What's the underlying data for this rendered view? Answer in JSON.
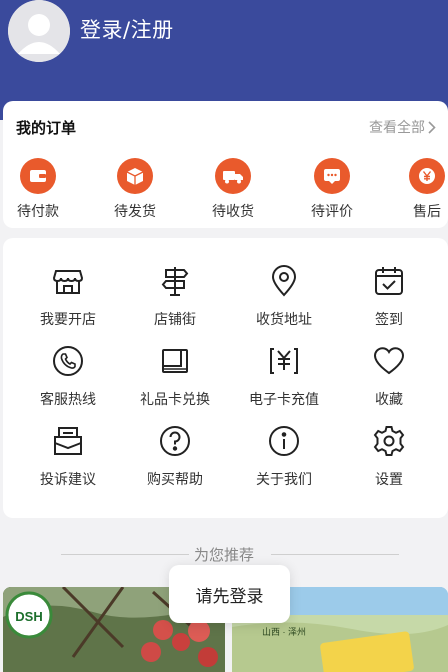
{
  "header": {
    "login_label": "登录/注册"
  },
  "orders": {
    "title": "我的订单",
    "view_all": "查看全部",
    "items": [
      {
        "label": "待付款",
        "icon": "wallet-icon"
      },
      {
        "label": "待发货",
        "icon": "box-icon"
      },
      {
        "label": "待收货",
        "icon": "truck-icon"
      },
      {
        "label": "待评价",
        "icon": "comment-icon"
      },
      {
        "label": "售后",
        "icon": "yen-icon"
      }
    ]
  },
  "services": [
    {
      "label": "我要开店",
      "icon": "store-icon"
    },
    {
      "label": "店铺街",
      "icon": "signpost-icon"
    },
    {
      "label": "收货地址",
      "icon": "location-icon"
    },
    {
      "label": "签到",
      "icon": "calendar-check-icon"
    },
    {
      "label": "客服热线",
      "icon": "phone-icon"
    },
    {
      "label": "礼品卡兑换",
      "icon": "gift-card-icon"
    },
    {
      "label": "电子卡充值",
      "icon": "yen-card-icon"
    },
    {
      "label": "收藏",
      "icon": "heart-icon"
    },
    {
      "label": "投诉建议",
      "icon": "mail-icon"
    },
    {
      "label": "购买帮助",
      "icon": "help-icon"
    },
    {
      "label": "关于我们",
      "icon": "info-icon"
    },
    {
      "label": "设置",
      "icon": "gear-icon"
    }
  ],
  "recommend": {
    "title": "为您推荐"
  },
  "products": [
    {
      "badge": "DSH"
    },
    {
      "caption": "山西 · 泽州"
    }
  ],
  "toast": {
    "text": "请先登录"
  },
  "colors": {
    "header_bg": "#3a4a9c",
    "accent": "#e95a2c"
  }
}
